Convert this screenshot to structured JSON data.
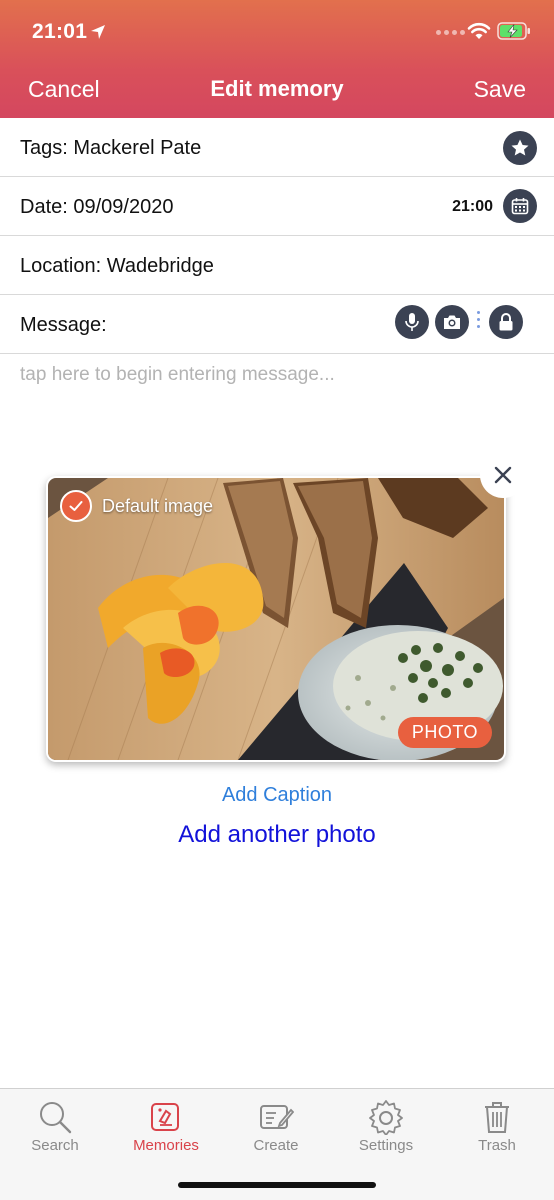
{
  "status_bar": {
    "time": "21:01"
  },
  "nav": {
    "cancel_label": "Cancel",
    "title": "Edit memory",
    "save_label": "Save"
  },
  "form": {
    "tags": {
      "label": "Tags:",
      "value": "Mackerel Pate"
    },
    "date": {
      "label": "Date:",
      "value": "09/09/2020",
      "time": "21:00"
    },
    "location": {
      "label": "Location:",
      "value": "Wadebridge"
    },
    "message": {
      "label": "Message:",
      "placeholder": "tap here to begin entering message..."
    }
  },
  "photo": {
    "default_label": "Default image",
    "badge": "PHOTO"
  },
  "actions": {
    "add_caption": "Add Caption",
    "add_another_photo": "Add another photo"
  },
  "tabbar": {
    "tabs": [
      {
        "label": "Search",
        "icon": "search-icon",
        "active": false
      },
      {
        "label": "Memories",
        "icon": "memories-icon",
        "active": true
      },
      {
        "label": "Create",
        "icon": "create-icon",
        "active": false
      },
      {
        "label": "Settings",
        "icon": "settings-icon",
        "active": false
      },
      {
        "label": "Trash",
        "icon": "trash-icon",
        "active": false
      }
    ]
  },
  "colors": {
    "header_top": "#e2704d",
    "header_bottom": "#d4475f",
    "accent": "#e8603f",
    "icon_dark": "#3b4253",
    "link_blue": "#2f7fdb",
    "link_dark_blue": "#1212d9",
    "tab_active": "#d9434a"
  }
}
